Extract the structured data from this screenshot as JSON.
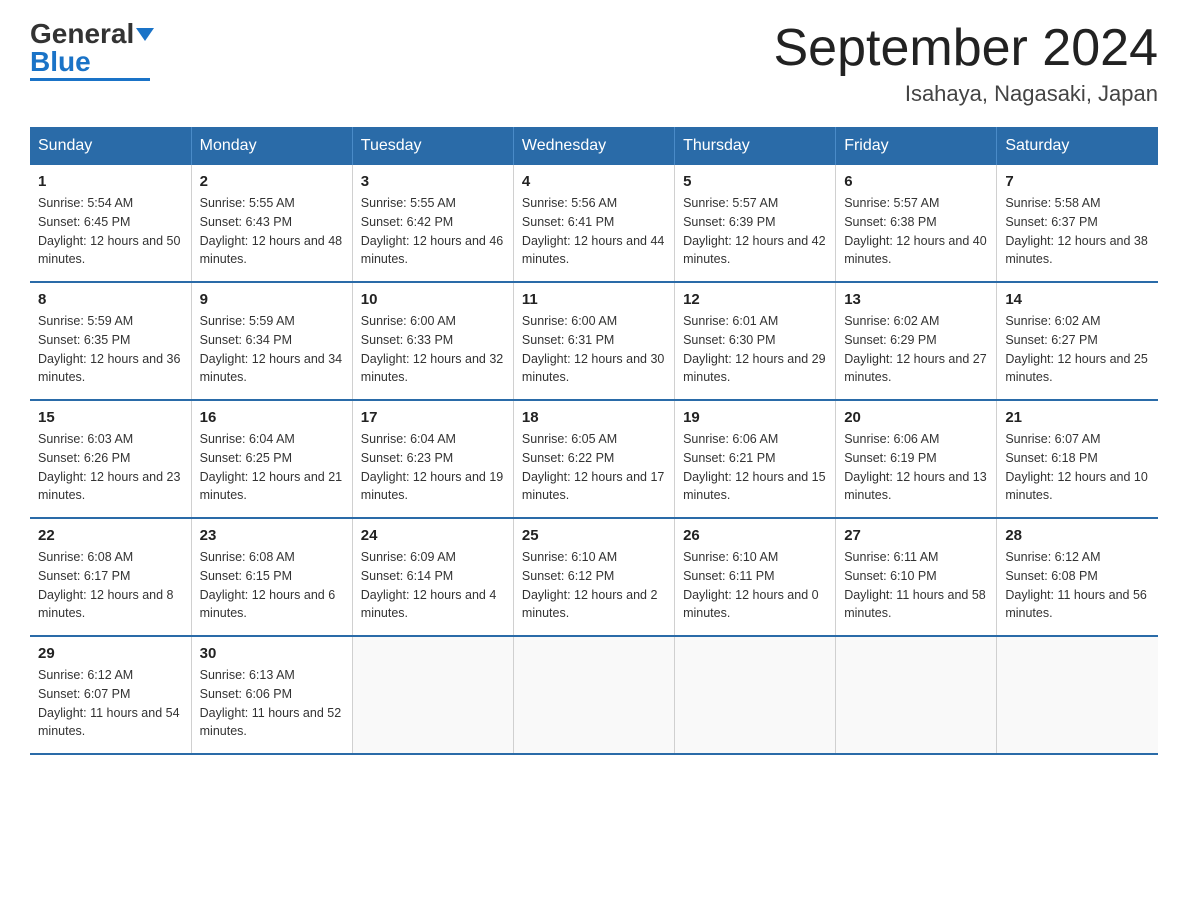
{
  "logo": {
    "text_general": "General",
    "text_blue": "Blue"
  },
  "header": {
    "month_title": "September 2024",
    "location": "Isahaya, Nagasaki, Japan"
  },
  "weekdays": [
    "Sunday",
    "Monday",
    "Tuesday",
    "Wednesday",
    "Thursday",
    "Friday",
    "Saturday"
  ],
  "weeks": [
    [
      {
        "day": "1",
        "sunrise": "5:54 AM",
        "sunset": "6:45 PM",
        "daylight": "12 hours and 50 minutes."
      },
      {
        "day": "2",
        "sunrise": "5:55 AM",
        "sunset": "6:43 PM",
        "daylight": "12 hours and 48 minutes."
      },
      {
        "day": "3",
        "sunrise": "5:55 AM",
        "sunset": "6:42 PM",
        "daylight": "12 hours and 46 minutes."
      },
      {
        "day": "4",
        "sunrise": "5:56 AM",
        "sunset": "6:41 PM",
        "daylight": "12 hours and 44 minutes."
      },
      {
        "day": "5",
        "sunrise": "5:57 AM",
        "sunset": "6:39 PM",
        "daylight": "12 hours and 42 minutes."
      },
      {
        "day": "6",
        "sunrise": "5:57 AM",
        "sunset": "6:38 PM",
        "daylight": "12 hours and 40 minutes."
      },
      {
        "day": "7",
        "sunrise": "5:58 AM",
        "sunset": "6:37 PM",
        "daylight": "12 hours and 38 minutes."
      }
    ],
    [
      {
        "day": "8",
        "sunrise": "5:59 AM",
        "sunset": "6:35 PM",
        "daylight": "12 hours and 36 minutes."
      },
      {
        "day": "9",
        "sunrise": "5:59 AM",
        "sunset": "6:34 PM",
        "daylight": "12 hours and 34 minutes."
      },
      {
        "day": "10",
        "sunrise": "6:00 AM",
        "sunset": "6:33 PM",
        "daylight": "12 hours and 32 minutes."
      },
      {
        "day": "11",
        "sunrise": "6:00 AM",
        "sunset": "6:31 PM",
        "daylight": "12 hours and 30 minutes."
      },
      {
        "day": "12",
        "sunrise": "6:01 AM",
        "sunset": "6:30 PM",
        "daylight": "12 hours and 29 minutes."
      },
      {
        "day": "13",
        "sunrise": "6:02 AM",
        "sunset": "6:29 PM",
        "daylight": "12 hours and 27 minutes."
      },
      {
        "day": "14",
        "sunrise": "6:02 AM",
        "sunset": "6:27 PM",
        "daylight": "12 hours and 25 minutes."
      }
    ],
    [
      {
        "day": "15",
        "sunrise": "6:03 AM",
        "sunset": "6:26 PM",
        "daylight": "12 hours and 23 minutes."
      },
      {
        "day": "16",
        "sunrise": "6:04 AM",
        "sunset": "6:25 PM",
        "daylight": "12 hours and 21 minutes."
      },
      {
        "day": "17",
        "sunrise": "6:04 AM",
        "sunset": "6:23 PM",
        "daylight": "12 hours and 19 minutes."
      },
      {
        "day": "18",
        "sunrise": "6:05 AM",
        "sunset": "6:22 PM",
        "daylight": "12 hours and 17 minutes."
      },
      {
        "day": "19",
        "sunrise": "6:06 AM",
        "sunset": "6:21 PM",
        "daylight": "12 hours and 15 minutes."
      },
      {
        "day": "20",
        "sunrise": "6:06 AM",
        "sunset": "6:19 PM",
        "daylight": "12 hours and 13 minutes."
      },
      {
        "day": "21",
        "sunrise": "6:07 AM",
        "sunset": "6:18 PM",
        "daylight": "12 hours and 10 minutes."
      }
    ],
    [
      {
        "day": "22",
        "sunrise": "6:08 AM",
        "sunset": "6:17 PM",
        "daylight": "12 hours and 8 minutes."
      },
      {
        "day": "23",
        "sunrise": "6:08 AM",
        "sunset": "6:15 PM",
        "daylight": "12 hours and 6 minutes."
      },
      {
        "day": "24",
        "sunrise": "6:09 AM",
        "sunset": "6:14 PM",
        "daylight": "12 hours and 4 minutes."
      },
      {
        "day": "25",
        "sunrise": "6:10 AM",
        "sunset": "6:12 PM",
        "daylight": "12 hours and 2 minutes."
      },
      {
        "day": "26",
        "sunrise": "6:10 AM",
        "sunset": "6:11 PM",
        "daylight": "12 hours and 0 minutes."
      },
      {
        "day": "27",
        "sunrise": "6:11 AM",
        "sunset": "6:10 PM",
        "daylight": "11 hours and 58 minutes."
      },
      {
        "day": "28",
        "sunrise": "6:12 AM",
        "sunset": "6:08 PM",
        "daylight": "11 hours and 56 minutes."
      }
    ],
    [
      {
        "day": "29",
        "sunrise": "6:12 AM",
        "sunset": "6:07 PM",
        "daylight": "11 hours and 54 minutes."
      },
      {
        "day": "30",
        "sunrise": "6:13 AM",
        "sunset": "6:06 PM",
        "daylight": "11 hours and 52 minutes."
      },
      null,
      null,
      null,
      null,
      null
    ]
  ]
}
